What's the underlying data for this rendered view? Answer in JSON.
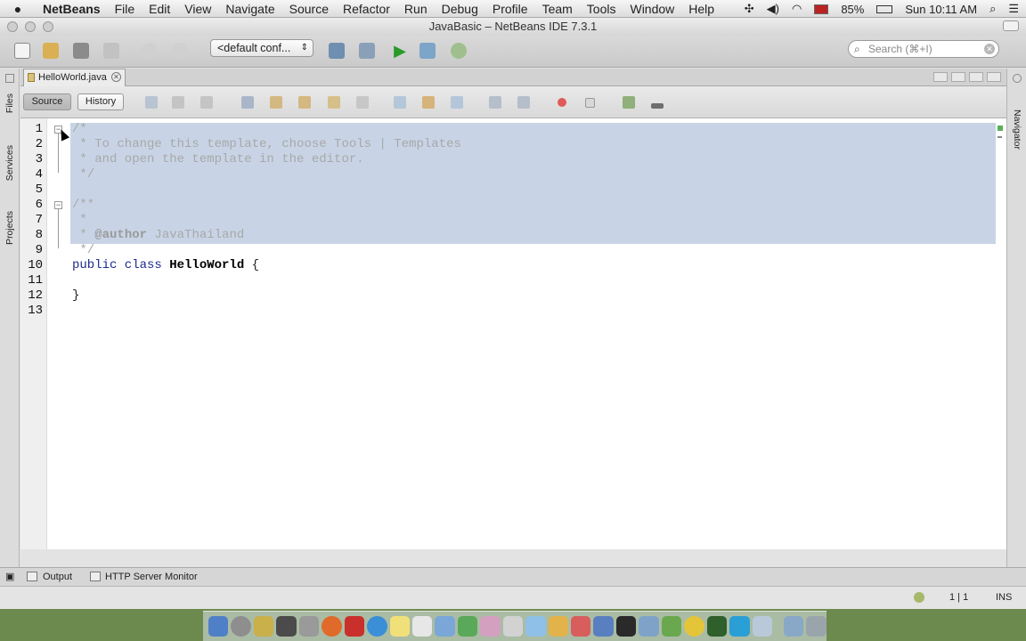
{
  "menubar": {
    "app": "NetBeans",
    "items": [
      "File",
      "Edit",
      "View",
      "Navigate",
      "Source",
      "Refactor",
      "Run",
      "Debug",
      "Profile",
      "Team",
      "Tools",
      "Window",
      "Help"
    ],
    "battery": "85%",
    "clock": "Sun 10:11 AM"
  },
  "window": {
    "title": "JavaBasic – NetBeans IDE 7.3.1"
  },
  "toolbar": {
    "config_value": "<default conf...",
    "search_placeholder": "Search (⌘+I)"
  },
  "side": {
    "left": [
      "Files",
      "Services",
      "Projects"
    ],
    "right": [
      "Navigator"
    ]
  },
  "tabs": [
    {
      "label": "HelloWorld.java"
    }
  ],
  "editor_toolbar": {
    "source_label": "Source",
    "history_label": "History"
  },
  "editor": {
    "line_numbers": [
      "1",
      "2",
      "3",
      "4",
      "5",
      "6",
      "7",
      "8",
      "9",
      "10",
      "11",
      "12",
      "13"
    ],
    "lines": {
      "l1": "/*",
      "l2": " * To change this template, choose Tools | Templates",
      "l3": " * and open the template in the editor.",
      "l4": " */",
      "l6": "/**",
      "l7": " *",
      "l8_prefix": " * ",
      "l8_tag": "@author",
      "l8_rest": " JavaThailand",
      "l9": " */",
      "l10_kw": "public class ",
      "l10_name": "HelloWorld",
      "l10_rest": " {",
      "l12": "}"
    }
  },
  "bottom": {
    "output_label": "Output",
    "http_label": "HTTP Server Monitor"
  },
  "status": {
    "position": "1 | 1",
    "mode": "INS"
  },
  "colors": {
    "selection": "#c8d4e6",
    "keyword": "#1b2c8f",
    "comment": "#a8a8a8"
  }
}
